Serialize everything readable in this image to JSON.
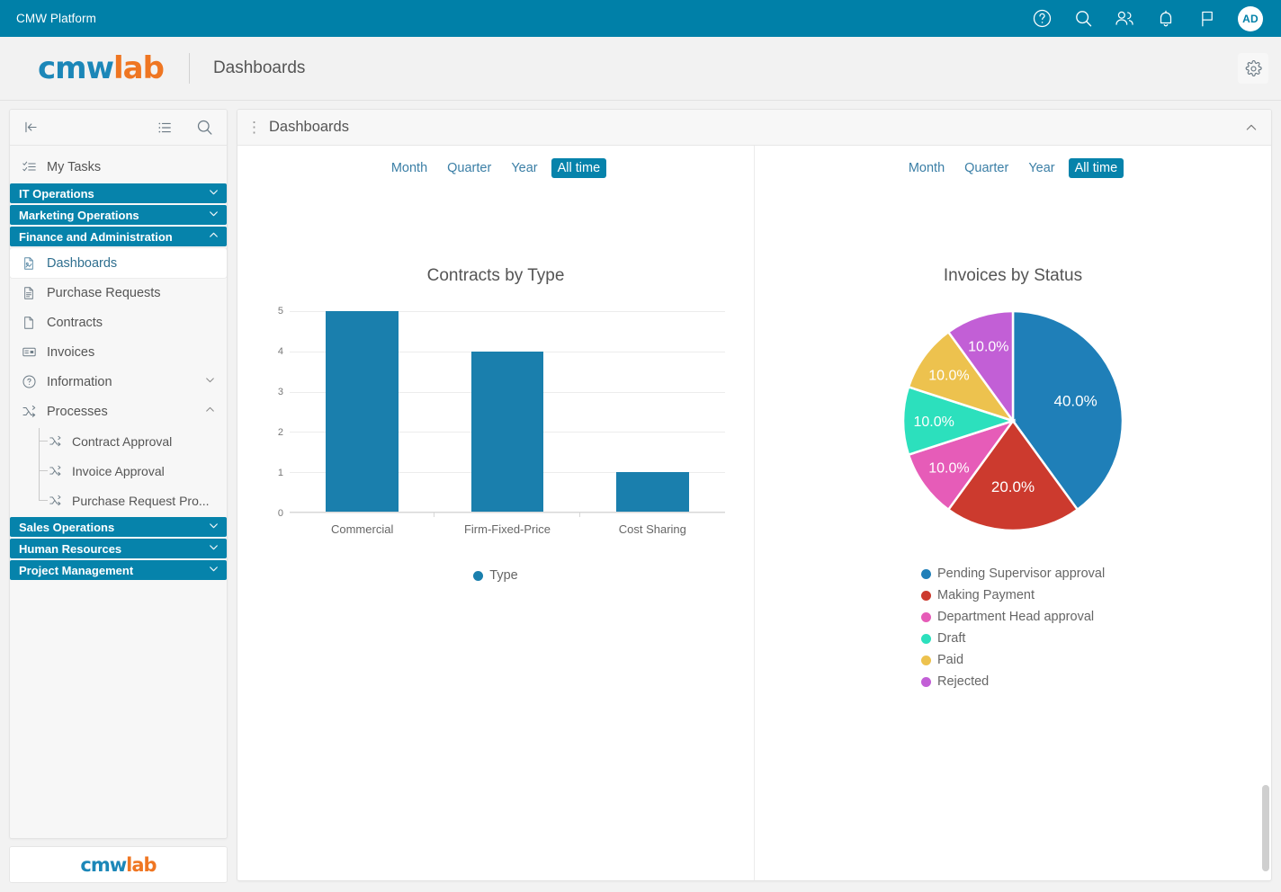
{
  "topbar": {
    "title": "CMW Platform",
    "icons": [
      "help-icon",
      "search-icon",
      "users-icon",
      "bell-icon",
      "flag-icon"
    ],
    "avatar_initials": "AD",
    "background": "#0080a8"
  },
  "brandbar": {
    "logo_first": "cmw",
    "logo_second": "lab",
    "page_title": "Dashboards",
    "gear_label": "gear-icon"
  },
  "sidebar": {
    "toolbar": [
      "collapse-panel-icon",
      "list-view-icon",
      "search-icon"
    ],
    "my_tasks": "My Tasks",
    "groups_top": [
      {
        "label": "IT Operations",
        "expanded": false
      },
      {
        "label": "Marketing Operations",
        "expanded": false
      },
      {
        "label": "Finance and Administration",
        "expanded": true
      }
    ],
    "items": [
      {
        "label": "Dashboards",
        "icon": "dashboard-file-icon",
        "selected": true
      },
      {
        "label": "Purchase Requests",
        "icon": "document-lines-icon",
        "selected": false
      },
      {
        "label": "Contracts",
        "icon": "document-icon",
        "selected": false
      },
      {
        "label": "Invoices",
        "icon": "invoice-card-icon",
        "selected": false
      }
    ],
    "collapsibles": [
      {
        "label": "Information",
        "icon": "info-circle-icon",
        "expanded": false
      },
      {
        "label": "Processes",
        "icon": "process-icon",
        "expanded": true
      }
    ],
    "process_children": [
      {
        "label": "Contract Approval",
        "icon": "process-icon"
      },
      {
        "label": "Invoice Approval",
        "icon": "process-icon"
      },
      {
        "label": "Purchase Request Pro...",
        "icon": "process-icon"
      }
    ],
    "groups_bottom": [
      {
        "label": "Sales Operations",
        "expanded": false
      },
      {
        "label": "Human Resources",
        "expanded": false
      },
      {
        "label": "Project Management",
        "expanded": false
      }
    ],
    "footer_logo_first": "cmw",
    "footer_logo_second": "lab"
  },
  "panel": {
    "title": "Dashboards",
    "drag_handle": "⋮",
    "collapse_icon": "chevron-up-icon"
  },
  "time_filter": {
    "options": [
      "Month",
      "Quarter",
      "Year",
      "All time"
    ],
    "selected": "All time"
  },
  "chart_data": [
    {
      "type": "bar",
      "title": "Contracts by Type",
      "categories": [
        "Commercial",
        "Firm-Fixed-Price",
        "Cost Sharing"
      ],
      "values": [
        5,
        4,
        1
      ],
      "series_name": "Type",
      "color": "#1a7fad",
      "xlabel": "",
      "ylabel": "",
      "ylim": [
        0,
        5
      ],
      "yticks": [
        0,
        1,
        2,
        3,
        4,
        5
      ],
      "grid": true,
      "legend_position": "bottom"
    },
    {
      "type": "pie",
      "title": "Invoices by Status",
      "labels": [
        "Pending Supervisor approval",
        "Making Payment",
        "Department Head approval",
        "Draft",
        "Paid",
        "Rejected"
      ],
      "values": [
        40.0,
        20.0,
        10.0,
        10.0,
        10.0,
        10.0
      ],
      "value_labels": [
        "40.0%",
        "20.0%",
        "10.0%",
        "10.0%",
        "10.0%",
        "10.0%"
      ],
      "colors": [
        "#1f7fb8",
        "#cc3a2e",
        "#e65cb8",
        "#2ce0bd",
        "#edc24e",
        "#c25fd6"
      ],
      "legend_position": "bottom",
      "start_angle": 0,
      "direction": "clockwise"
    }
  ]
}
